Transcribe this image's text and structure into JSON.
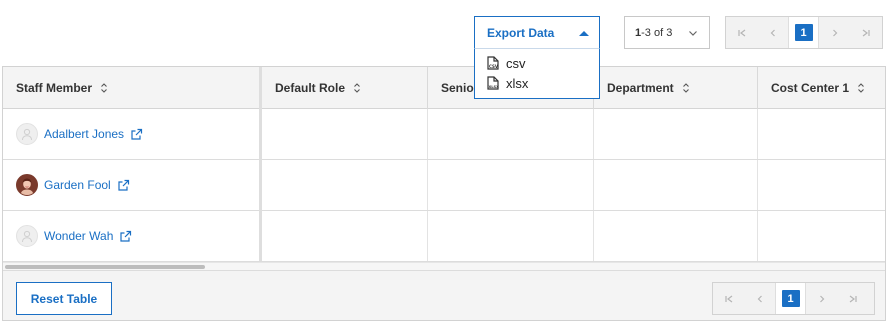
{
  "toolbar": {
    "export_label": "Export Data",
    "export_options": [
      "csv",
      "xlsx"
    ],
    "range_prefix": "1",
    "range_suffix": "-3 of 3",
    "pager_current": "1"
  },
  "table": {
    "columns": [
      "Staff Member",
      "Default Role",
      "Senio",
      "Department",
      "Cost Center 1"
    ],
    "rows": [
      {
        "name": "Adalbert Jones",
        "avatar": "placeholder"
      },
      {
        "name": "Garden Fool",
        "avatar": "photo"
      },
      {
        "name": "Wonder Wah",
        "avatar": "placeholder"
      }
    ]
  },
  "footer": {
    "reset_label": "Reset Table",
    "pager_current": "1"
  },
  "colors": {
    "accent": "#1a6fc4",
    "header_bg": "#f4f4f4",
    "border": "#d2d2d2"
  },
  "icons": {
    "sort": "sort-updown-icon",
    "external": "external-link-icon",
    "file": "file-icon"
  }
}
